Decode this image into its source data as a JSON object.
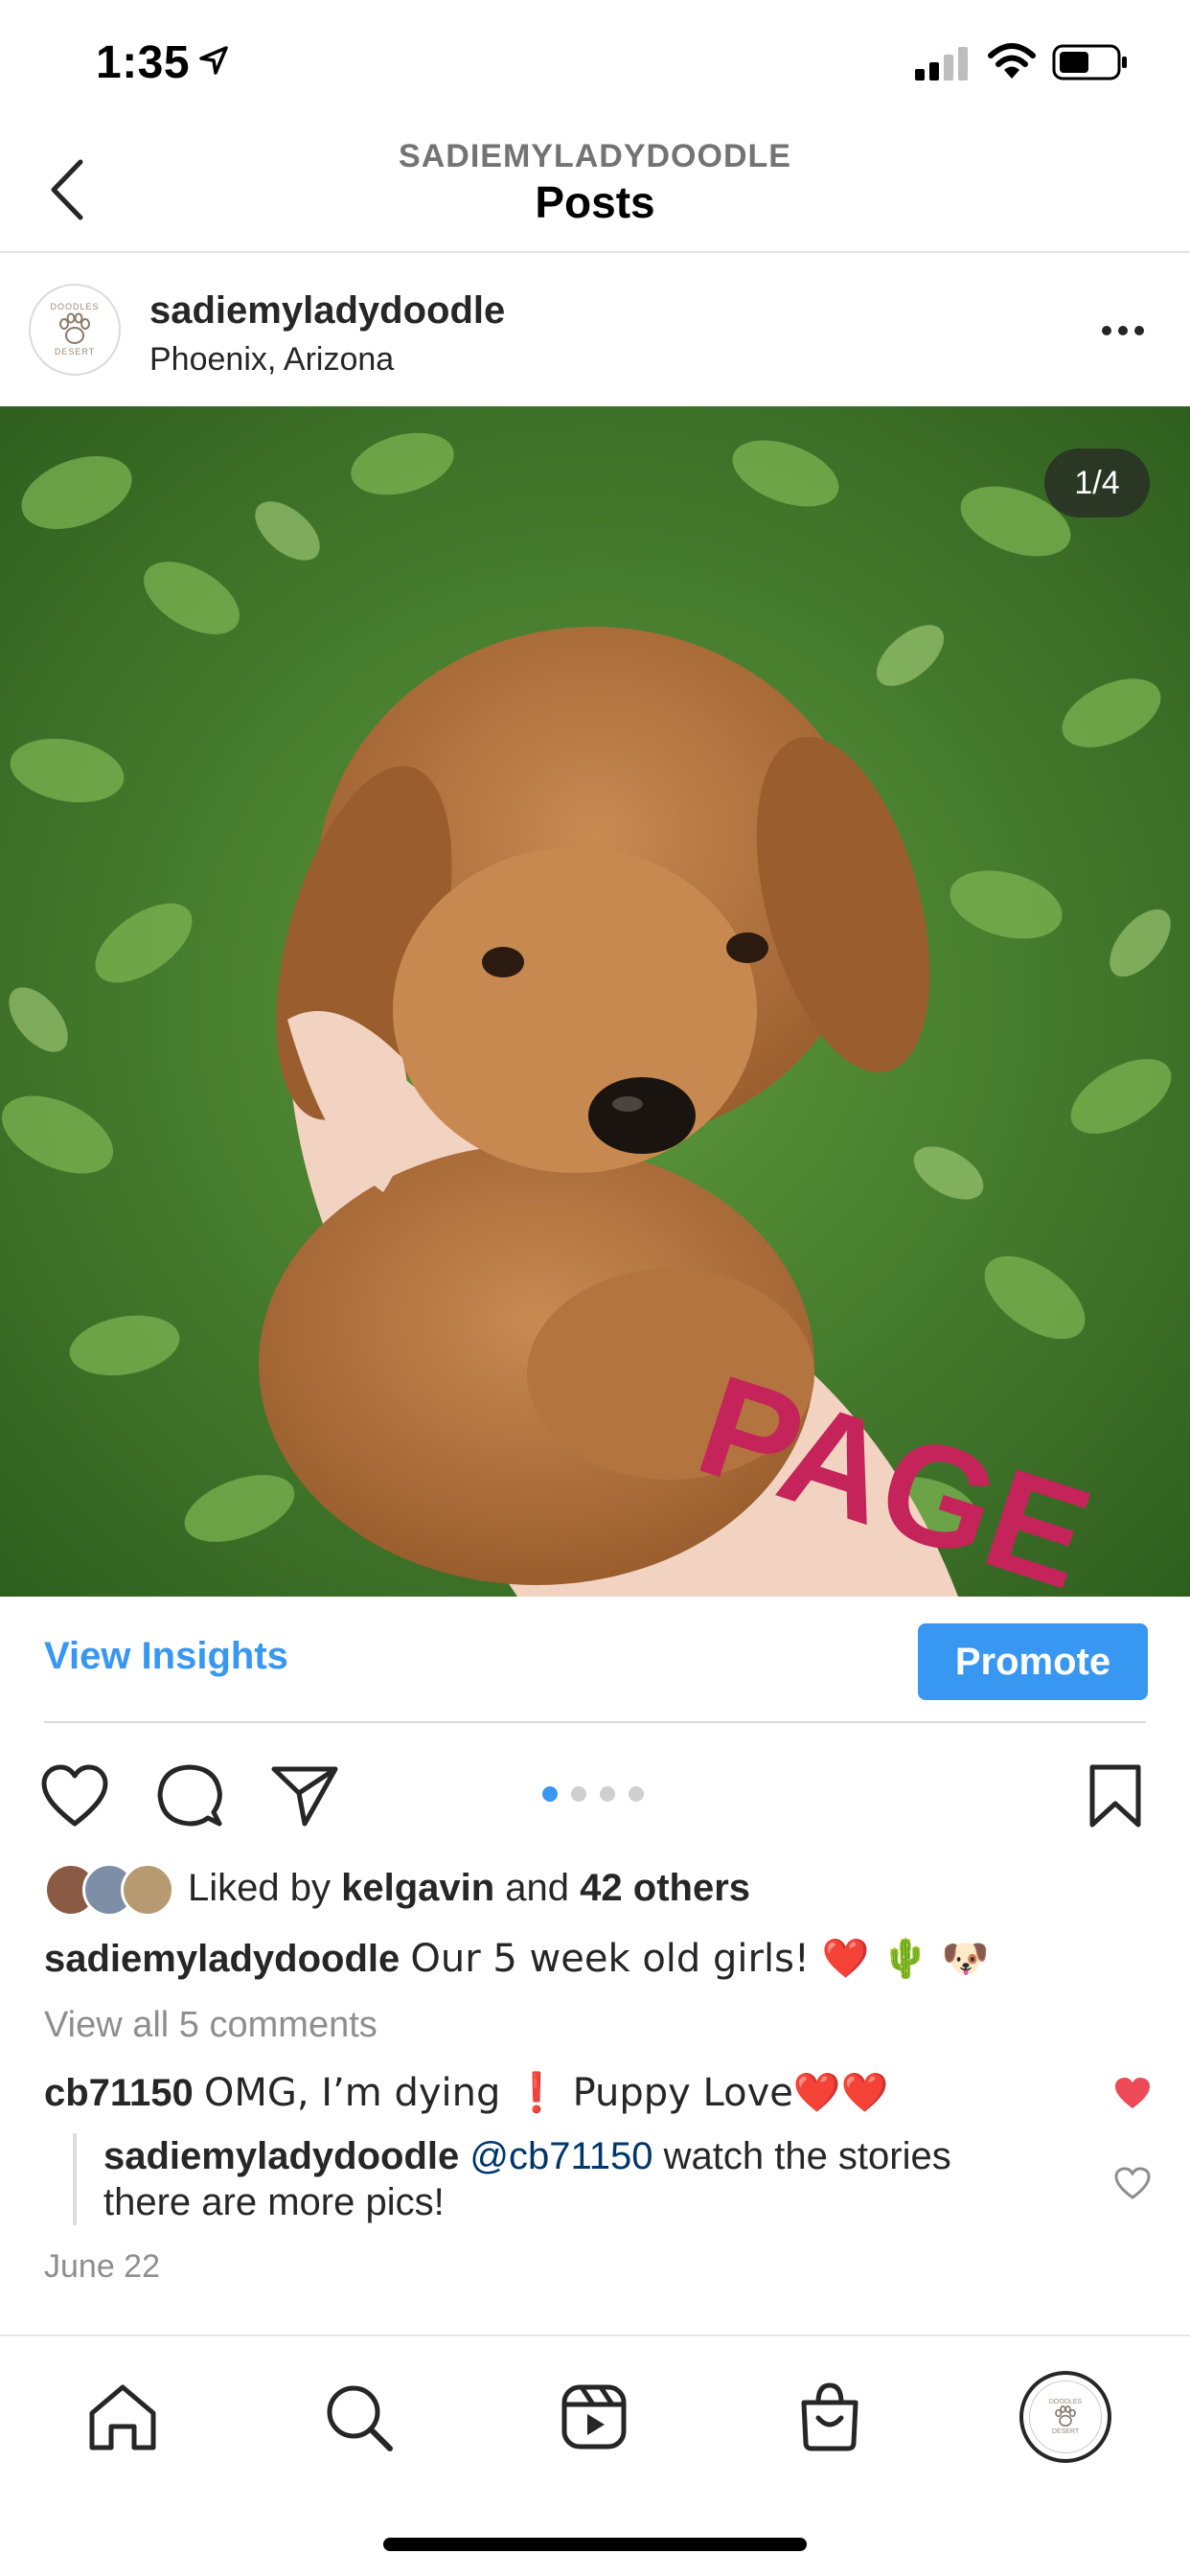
{
  "status_bar": {
    "time": "1:35",
    "icons": [
      "location-arrow-icon",
      "signal-icon",
      "wifi-icon",
      "battery-icon"
    ]
  },
  "header": {
    "account": "SADIEMYLADYDOODLE",
    "title": "Posts"
  },
  "post": {
    "avatar_text_top": "DOODLES",
    "avatar_text_bottom": "DESERT",
    "username": "sadiemyladydoodle",
    "location": "Phoenix, Arizona",
    "image_counter": "1/4",
    "image_overlay_text": "PAGE",
    "carousel_total": 4,
    "carousel_active": 1
  },
  "insights": {
    "view_insights_label": "View Insights",
    "promote_label": "Promote"
  },
  "likes": {
    "prefix": "Liked by ",
    "user": "kelgavin",
    "middle": " and ",
    "others": "42 others"
  },
  "caption": {
    "username": "sadiemyladydoodle",
    "text": "Our 5 week old girls! ❤️ 🌵 🐶"
  },
  "comments": {
    "view_all": "View all 5 comments",
    "items": [
      {
        "username": "cb71150",
        "text": "OMG, I’m dying ❗ Puppy Love❤️❤️",
        "liked": true
      },
      {
        "username": "sadiemyladydoodle",
        "mention": "@cb71150",
        "text": " watch the stories there are more pics!",
        "liked": false
      }
    ],
    "date": "June 22"
  },
  "colors": {
    "accent": "#3897f0",
    "liked_heart": "#ed4956",
    "text": "#262626",
    "muted": "#8e8e8e"
  },
  "tab_bar": {
    "icons": [
      "home-icon",
      "search-icon",
      "reels-icon",
      "shop-icon",
      "profile-avatar"
    ],
    "profile_text_top": "DOODLES",
    "profile_text_bottom": "DESERT"
  }
}
